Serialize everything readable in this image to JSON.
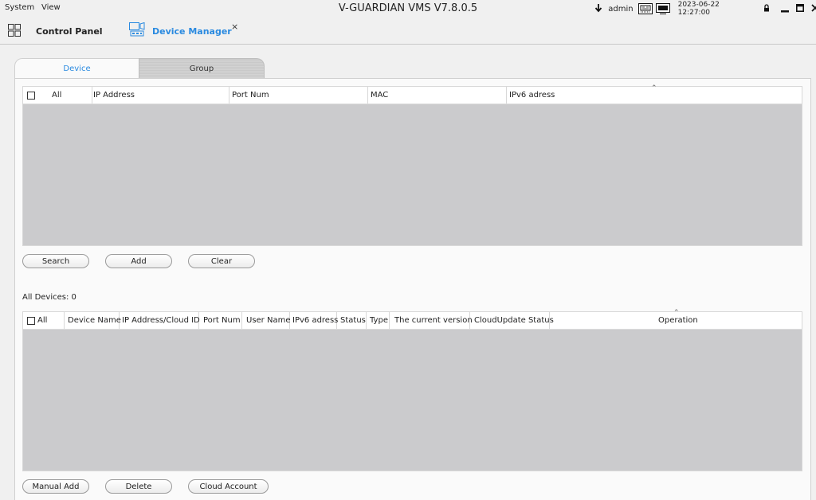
{
  "titlebar": {
    "menu": [
      "System",
      "View"
    ],
    "app_title": "V-GUARDIAN VMS V7.8.0.5",
    "user": "admin",
    "datetime": "2023-06-22 12:27:00"
  },
  "nav": {
    "control_panel": "Control Panel",
    "device_manager": "Device Manager",
    "close": "×"
  },
  "tabs": [
    {
      "label": "Device",
      "active": true
    },
    {
      "label": "Group",
      "active": false
    }
  ],
  "search_table": {
    "columns": [
      "All",
      "IP Address",
      "Port Num",
      "MAC",
      "IPv6 adress"
    ],
    "rows": []
  },
  "search_buttons": {
    "search": "Search",
    "add": "Add",
    "clear": "Clear"
  },
  "devices_count_label": "All Devices: 0",
  "devices_table": {
    "columns": [
      "All",
      "Device Name",
      "IP Address/Cloud ID",
      "Port Num",
      "User Name",
      "IPv6 adress",
      "Status",
      "Type",
      "The current version",
      "CloudUpdate Status",
      "Operation"
    ],
    "rows": []
  },
  "device_buttons": {
    "manual_add": "Manual Add",
    "delete": "Delete",
    "cloud_account": "Cloud Account"
  },
  "colors": {
    "accent": "#2a8ae0",
    "table_body": "#cbcbcd",
    "background": "#f0f0f0"
  }
}
